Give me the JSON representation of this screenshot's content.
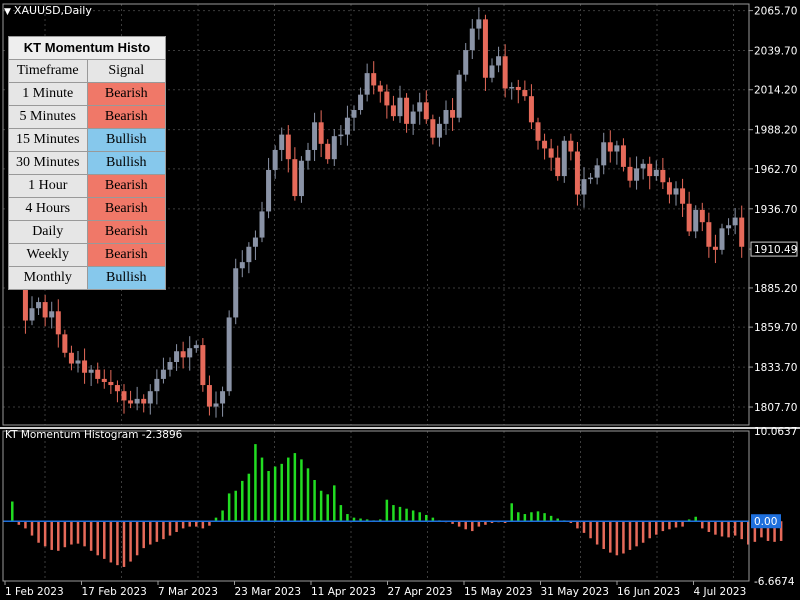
{
  "window": {
    "symbol_title": "XAUUSD,Daily",
    "dropdown_icon": "triangle-down-icon"
  },
  "indicator": {
    "label": "KT Momentum Histogram -2.3896"
  },
  "panel": {
    "title": "KT Momentum Histo",
    "col_timeframe": "Timeframe",
    "col_signal": "Signal",
    "rows": [
      {
        "timeframe": "1 Minute",
        "signal": "Bearish"
      },
      {
        "timeframe": "5 Minutes",
        "signal": "Bearish"
      },
      {
        "timeframe": "15 Minutes",
        "signal": "Bullish"
      },
      {
        "timeframe": "30 Minutes",
        "signal": "Bullish"
      },
      {
        "timeframe": "1 Hour",
        "signal": "Bearish"
      },
      {
        "timeframe": "4 Hours",
        "signal": "Bearish"
      },
      {
        "timeframe": "Daily",
        "signal": "Bearish"
      },
      {
        "timeframe": "Weekly",
        "signal": "Bearish"
      },
      {
        "timeframe": "Monthly",
        "signal": "Bullish"
      }
    ]
  },
  "colors": {
    "bull_candle": "#8a93a6",
    "bear_candle": "#e66a5a",
    "hist_pos": "#22dd22",
    "hist_neg": "#e66a5a",
    "zero_line": "#1e6fdc",
    "grid": "#3c3c3c",
    "bearish_cell": "#f07868",
    "bullish_cell": "#86c8ec"
  },
  "chart_data": [
    {
      "type": "candlestick",
      "title": "XAUUSD,Daily",
      "current_price": "1910.49",
      "y_ticks": [
        "2065.70",
        "2039.70",
        "2014.20",
        "1988.20",
        "1962.70",
        "1936.70",
        "1910.49",
        "1885.20",
        "1859.70",
        "1833.70",
        "1807.70"
      ],
      "ylim": [
        1796,
        2070
      ],
      "x_ticks": [
        "1 Feb 2023",
        "17 Feb 2023",
        "7 Mar 2023",
        "23 Mar 2023",
        "11 Apr 2023",
        "27 Apr 2023",
        "15 May 2023",
        "31 May 2023",
        "16 Jun 2023",
        "4 Jul 2023"
      ],
      "closes": [
        1952,
        1929,
        1864,
        1872,
        1876,
        1866,
        1870,
        1855,
        1843,
        1836,
        1838,
        1830,
        1832,
        1826,
        1824,
        1822,
        1818,
        1812,
        1810,
        1813,
        1810,
        1818,
        1826,
        1832,
        1837,
        1844,
        1840,
        1846,
        1848,
        1822,
        1808,
        1810,
        1818,
        1866,
        1898,
        1902,
        1912,
        1918,
        1935,
        1962,
        1975,
        1985,
        1969,
        1945,
        1968,
        1975,
        1993,
        1979,
        1969,
        1984,
        1985,
        1996,
        2001,
        2011,
        2025,
        2017,
        2013,
        2004,
        1997,
        2009,
        1992,
        2000,
        2006,
        1995,
        1983,
        1992,
        2001,
        1996,
        2024,
        2040,
        2054,
        2060,
        2022,
        2030,
        2036,
        2015,
        2016,
        2014,
        2010,
        1993,
        1981,
        1976,
        1970,
        1958,
        1981,
        1974,
        1946,
        1956,
        1957,
        1965,
        1980,
        1974,
        1978,
        1964,
        1955,
        1963,
        1966,
        1958,
        1962,
        1954,
        1946,
        1950,
        1940,
        1922,
        1936,
        1928,
        1912,
        1910,
        1924,
        1926,
        1931,
        1912
      ]
    },
    {
      "type": "bar",
      "title": "KT Momentum Histogram -2.3896",
      "y_ticks": [
        "10.0637",
        "0.00",
        "-6.6674"
      ],
      "ylim": [
        -6.6674,
        10.0637
      ],
      "values": [
        2.2,
        -0.4,
        -0.8,
        -1.6,
        -2.4,
        -2.8,
        -3.2,
        -3.3,
        -2.9,
        -2.6,
        -2.5,
        -2.8,
        -3.3,
        -3.8,
        -4.2,
        -4.6,
        -4.9,
        -5.1,
        -4.5,
        -3.8,
        -3.0,
        -2.6,
        -2.3,
        -2.0,
        -1.6,
        -1.2,
        -0.8,
        -0.6,
        -0.6,
        -0.8,
        -0.5,
        0.4,
        1.2,
        3.1,
        3.4,
        4.5,
        5.3,
        8.6,
        7.1,
        5.6,
        6.1,
        6.4,
        7.1,
        7.6,
        6.9,
        5.9,
        4.6,
        3.4,
        3.0,
        4.0,
        1.8,
        0.8,
        0.4,
        0.3,
        0.2,
        0.1,
        0.2,
        2.4,
        1.8,
        1.6,
        1.4,
        1.2,
        1.0,
        0.7,
        0.4,
        0.1,
        -0.1,
        -0.3,
        -0.6,
        -0.9,
        -1.1,
        -0.6,
        -0.4,
        -0.2,
        -0.1,
        -0.2,
        2.0,
        1.0,
        0.8,
        1.0,
        1.1,
        0.9,
        0.6,
        0.3,
        0.1,
        -0.2,
        -0.8,
        -1.3,
        -1.9,
        -2.6,
        -3.1,
        -3.5,
        -3.8,
        -3.6,
        -3.2,
        -2.8,
        -2.4,
        -1.9,
        -1.5,
        -1.1,
        -0.9,
        -0.7,
        -0.6,
        0.2,
        0.5,
        -0.8,
        -1.2,
        -1.5,
        -1.7,
        -1.8,
        -1.6,
        -2.0,
        -2.6,
        -2.3,
        -1.8,
        -2.2,
        -2.3,
        -2.2
      ]
    }
  ]
}
